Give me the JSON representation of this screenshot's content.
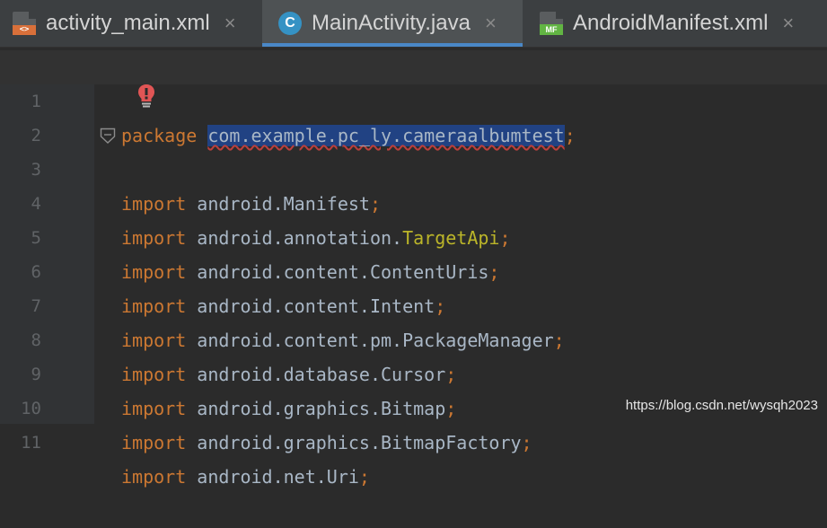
{
  "tabs": [
    {
      "label": "activity_main.xml",
      "icon": "xml-file-icon",
      "icon_text": "<>",
      "active": false
    },
    {
      "label": "MainActivity.java",
      "icon": "java-class-icon",
      "icon_text": "C",
      "active": true
    },
    {
      "label": "AndroidManifest.xml",
      "icon": "manifest-file-icon",
      "icon_text": "MF",
      "active": false
    }
  ],
  "close_glyph": "×",
  "lines": [
    {
      "num": "1",
      "kw": "package",
      "rest": "com.example.pc_ly.cameraalbumtest",
      "semi": ";"
    },
    {
      "num": "2"
    },
    {
      "num": "3",
      "kw": "import",
      "pkg": "android.",
      "cls": "Manifest",
      "semi": ";"
    },
    {
      "num": "4",
      "kw": "import",
      "pkg": "android.annotation.",
      "cls": "TargetApi",
      "semi": ";"
    },
    {
      "num": "5",
      "kw": "import",
      "pkg": "android.content.",
      "cls": "ContentUris",
      "semi": ";"
    },
    {
      "num": "6",
      "kw": "import",
      "pkg": "android.content.",
      "cls": "Intent",
      "semi": ";"
    },
    {
      "num": "7",
      "kw": "import",
      "pkg": "android.content.pm.",
      "cls": "PackageManager",
      "semi": ";"
    },
    {
      "num": "8",
      "kw": "import",
      "pkg": "android.database.",
      "cls": "Cursor",
      "semi": ";"
    },
    {
      "num": "9",
      "kw": "import",
      "pkg": "android.graphics.",
      "cls": "Bitmap",
      "semi": ";"
    },
    {
      "num": "10",
      "kw": "import",
      "pkg": "android.graphics.",
      "cls": "BitmapFactory",
      "semi": ";"
    },
    {
      "num": "11",
      "kw": "import",
      "pkg": "android.net.",
      "cls": "Uri",
      "semi": ";"
    }
  ],
  "watermark": "https://blog.csdn.net/wysqh2023",
  "colors": {
    "keyword": "#cc7832",
    "annotation": "#bbb529",
    "text": "#a9b7c6",
    "selection": "#214283",
    "background": "#2b2b2b"
  }
}
